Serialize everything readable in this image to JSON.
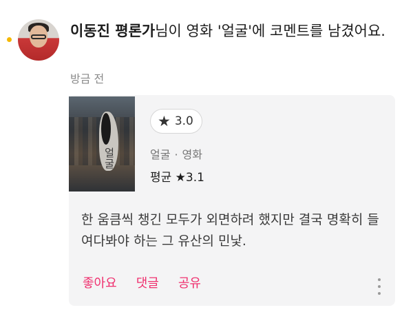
{
  "notification": {
    "user_name": "이동진 평론가",
    "message": "님이 영화 '얼굴'에 코멘트를 남겼어요.",
    "time": "방금 전"
  },
  "card": {
    "rating": "3.0",
    "poster_title": "얼굴",
    "movie_title": "얼굴",
    "separator": "·",
    "category": "영화",
    "average": "평균 ★3.1",
    "comment": "한 움큼씩 챙긴 모두가 외면하려 했지만 결국 명확히 들여다봐야 하는 그 유산의 민낯.",
    "actions": {
      "like": "좋아요",
      "reply": "댓글",
      "share": "공유"
    }
  },
  "icons": {
    "star": "star-icon",
    "more": "more-vertical-icon"
  },
  "colors": {
    "accent": "#ef2f6e",
    "unread_dot": "#f5b800",
    "card_bg": "#f4f4f5"
  }
}
